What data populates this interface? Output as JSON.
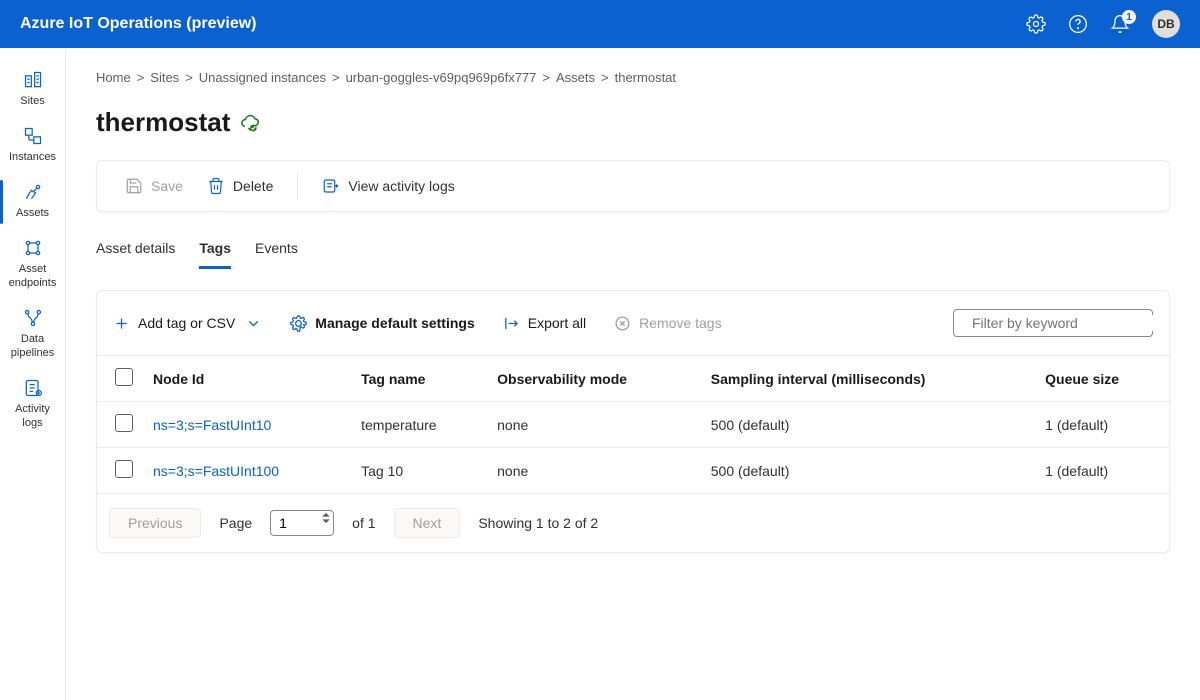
{
  "header": {
    "title": "Azure IoT Operations (preview)",
    "notification_count": "1",
    "avatar_initials": "DB"
  },
  "nav": [
    {
      "label": "Sites"
    },
    {
      "label": "Instances"
    },
    {
      "label": "Assets"
    },
    {
      "label": "Asset endpoints"
    },
    {
      "label": "Data pipelines"
    },
    {
      "label": "Activity logs"
    }
  ],
  "breadcrumbs": {
    "0": "Home",
    "1": "Sites",
    "2": "Unassigned instances",
    "3": "urban-goggles-v69pq969p6fx777",
    "4": "Assets",
    "5": "thermostat"
  },
  "page": {
    "title": "thermostat"
  },
  "toolbar": {
    "save": "Save",
    "delete": "Delete",
    "activity": "View activity logs"
  },
  "tabs": {
    "0": "Asset details",
    "1": "Tags",
    "2": "Events"
  },
  "grid": {
    "toolbar": {
      "add": "Add tag or CSV",
      "manage": "Manage default settings",
      "export": "Export all",
      "remove": "Remove tags",
      "filter_placeholder": "Filter by keyword"
    },
    "columns": {
      "0": "Node Id",
      "1": "Tag name",
      "2": "Observability mode",
      "3": "Sampling interval (milliseconds)",
      "4": "Queue size"
    },
    "rows": {
      "0": {
        "nodeId": "ns=3;s=FastUInt10",
        "tagName": "temperature",
        "obs": "none",
        "sampling": "500 (default)",
        "queue": "1 (default)"
      },
      "1": {
        "nodeId": "ns=3;s=FastUInt100",
        "tagName": "Tag 10",
        "obs": "none",
        "sampling": "500 (default)",
        "queue": "1 (default)"
      }
    },
    "pager": {
      "prev": "Previous",
      "page_label": "Page",
      "page_value": "1",
      "of": "of 1",
      "next": "Next",
      "showing": "Showing 1 to 2 of 2"
    }
  }
}
